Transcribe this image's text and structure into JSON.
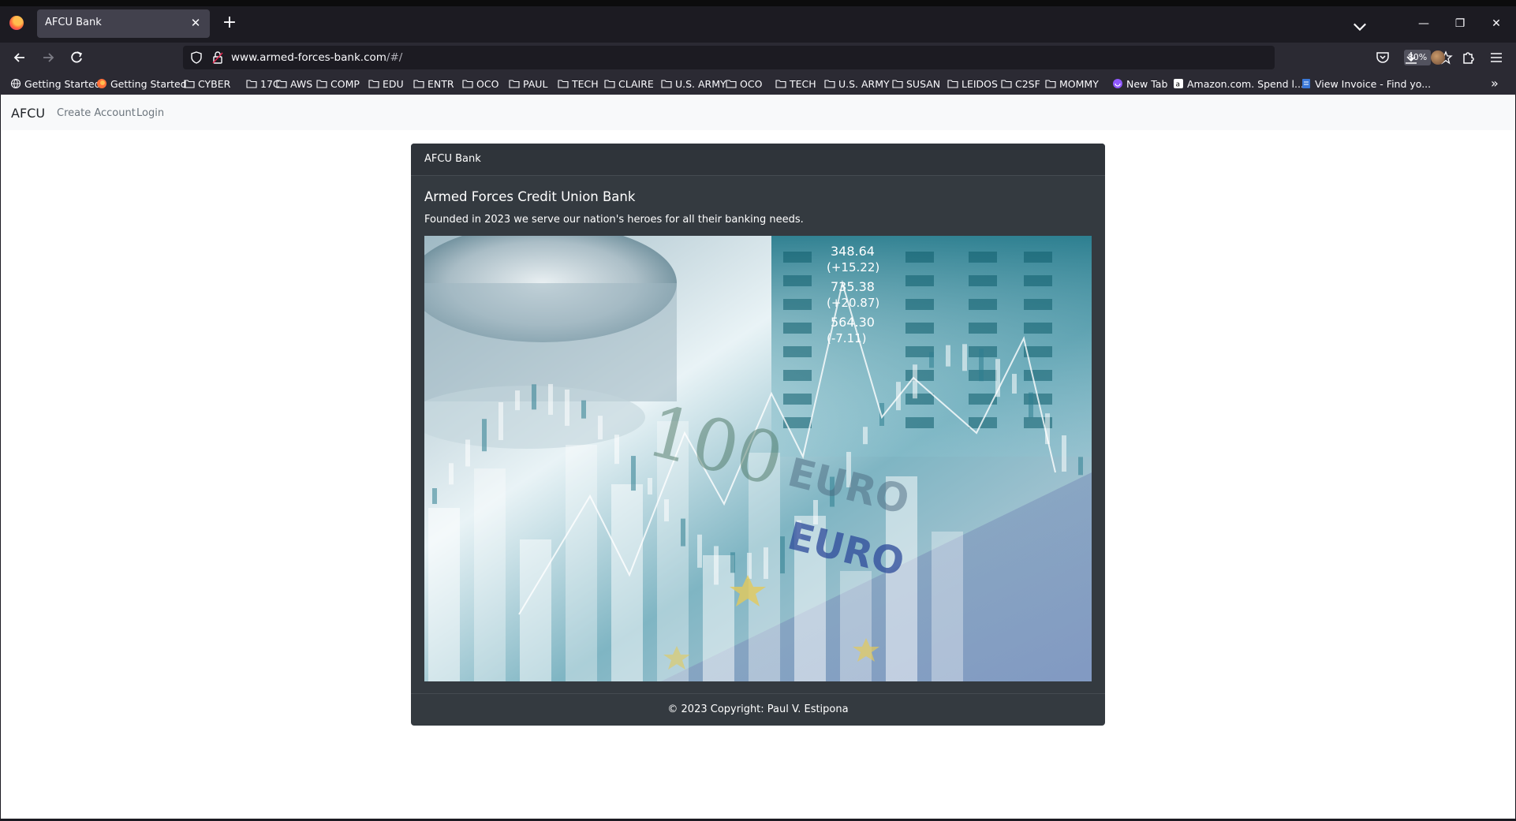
{
  "browser": {
    "tab": {
      "title": "AFCU Bank"
    },
    "url": {
      "host": "www.armed-forces-bank.com",
      "path": "/#/"
    },
    "zoom": "80%",
    "bookmarks": [
      {
        "label": "Getting Started",
        "icon": "globe-icon"
      },
      {
        "label": "Getting Started",
        "icon": "firefox-icon"
      },
      {
        "label": "CYBER",
        "icon": "folder-icon"
      },
      {
        "label": "17C",
        "icon": "folder-icon"
      },
      {
        "label": "AWS",
        "icon": "folder-icon"
      },
      {
        "label": "COMP",
        "icon": "folder-icon"
      },
      {
        "label": "EDU",
        "icon": "folder-icon"
      },
      {
        "label": "ENTR",
        "icon": "folder-icon"
      },
      {
        "label": "OCO",
        "icon": "folder-icon"
      },
      {
        "label": "PAUL",
        "icon": "folder-icon"
      },
      {
        "label": "TECH",
        "icon": "folder-icon"
      },
      {
        "label": "CLAIRE",
        "icon": "folder-icon"
      },
      {
        "label": "U.S. ARMY",
        "icon": "folder-icon"
      },
      {
        "label": "OCO",
        "icon": "folder-icon"
      },
      {
        "label": "TECH",
        "icon": "folder-icon"
      },
      {
        "label": "U.S. ARMY",
        "icon": "folder-icon"
      },
      {
        "label": "SUSAN",
        "icon": "folder-icon"
      },
      {
        "label": "LEIDOS",
        "icon": "folder-icon"
      },
      {
        "label": "C2SF",
        "icon": "folder-icon"
      },
      {
        "label": "MOMMY",
        "icon": "folder-icon"
      },
      {
        "label": "New Tab",
        "icon": "newtab-icon"
      },
      {
        "label": "Amazon.com. Spend l...",
        "icon": "amazon-icon"
      },
      {
        "label": "View Invoice - Find yo...",
        "icon": "invoice-icon"
      }
    ]
  },
  "site": {
    "brand": "AFCU",
    "nav": {
      "create_account": "Create Account",
      "login": "Login"
    },
    "card": {
      "header": "AFCU Bank",
      "title": "Armed Forces Credit Union Bank",
      "text": "Founded in 2023 we serve our nation's heroes for all their banking needs.",
      "footer": "© 2023 Copyright: Paul V. Estipona"
    },
    "hero_ticker": [
      {
        "price": "348.64",
        "change": "(+15.22)"
      },
      {
        "price": "735.38",
        "change": "(+20.87)"
      },
      {
        "price": "564.30",
        "change": "(-7.11)"
      }
    ],
    "hero_banknote": {
      "amount": "100",
      "word": "EURO"
    }
  }
}
